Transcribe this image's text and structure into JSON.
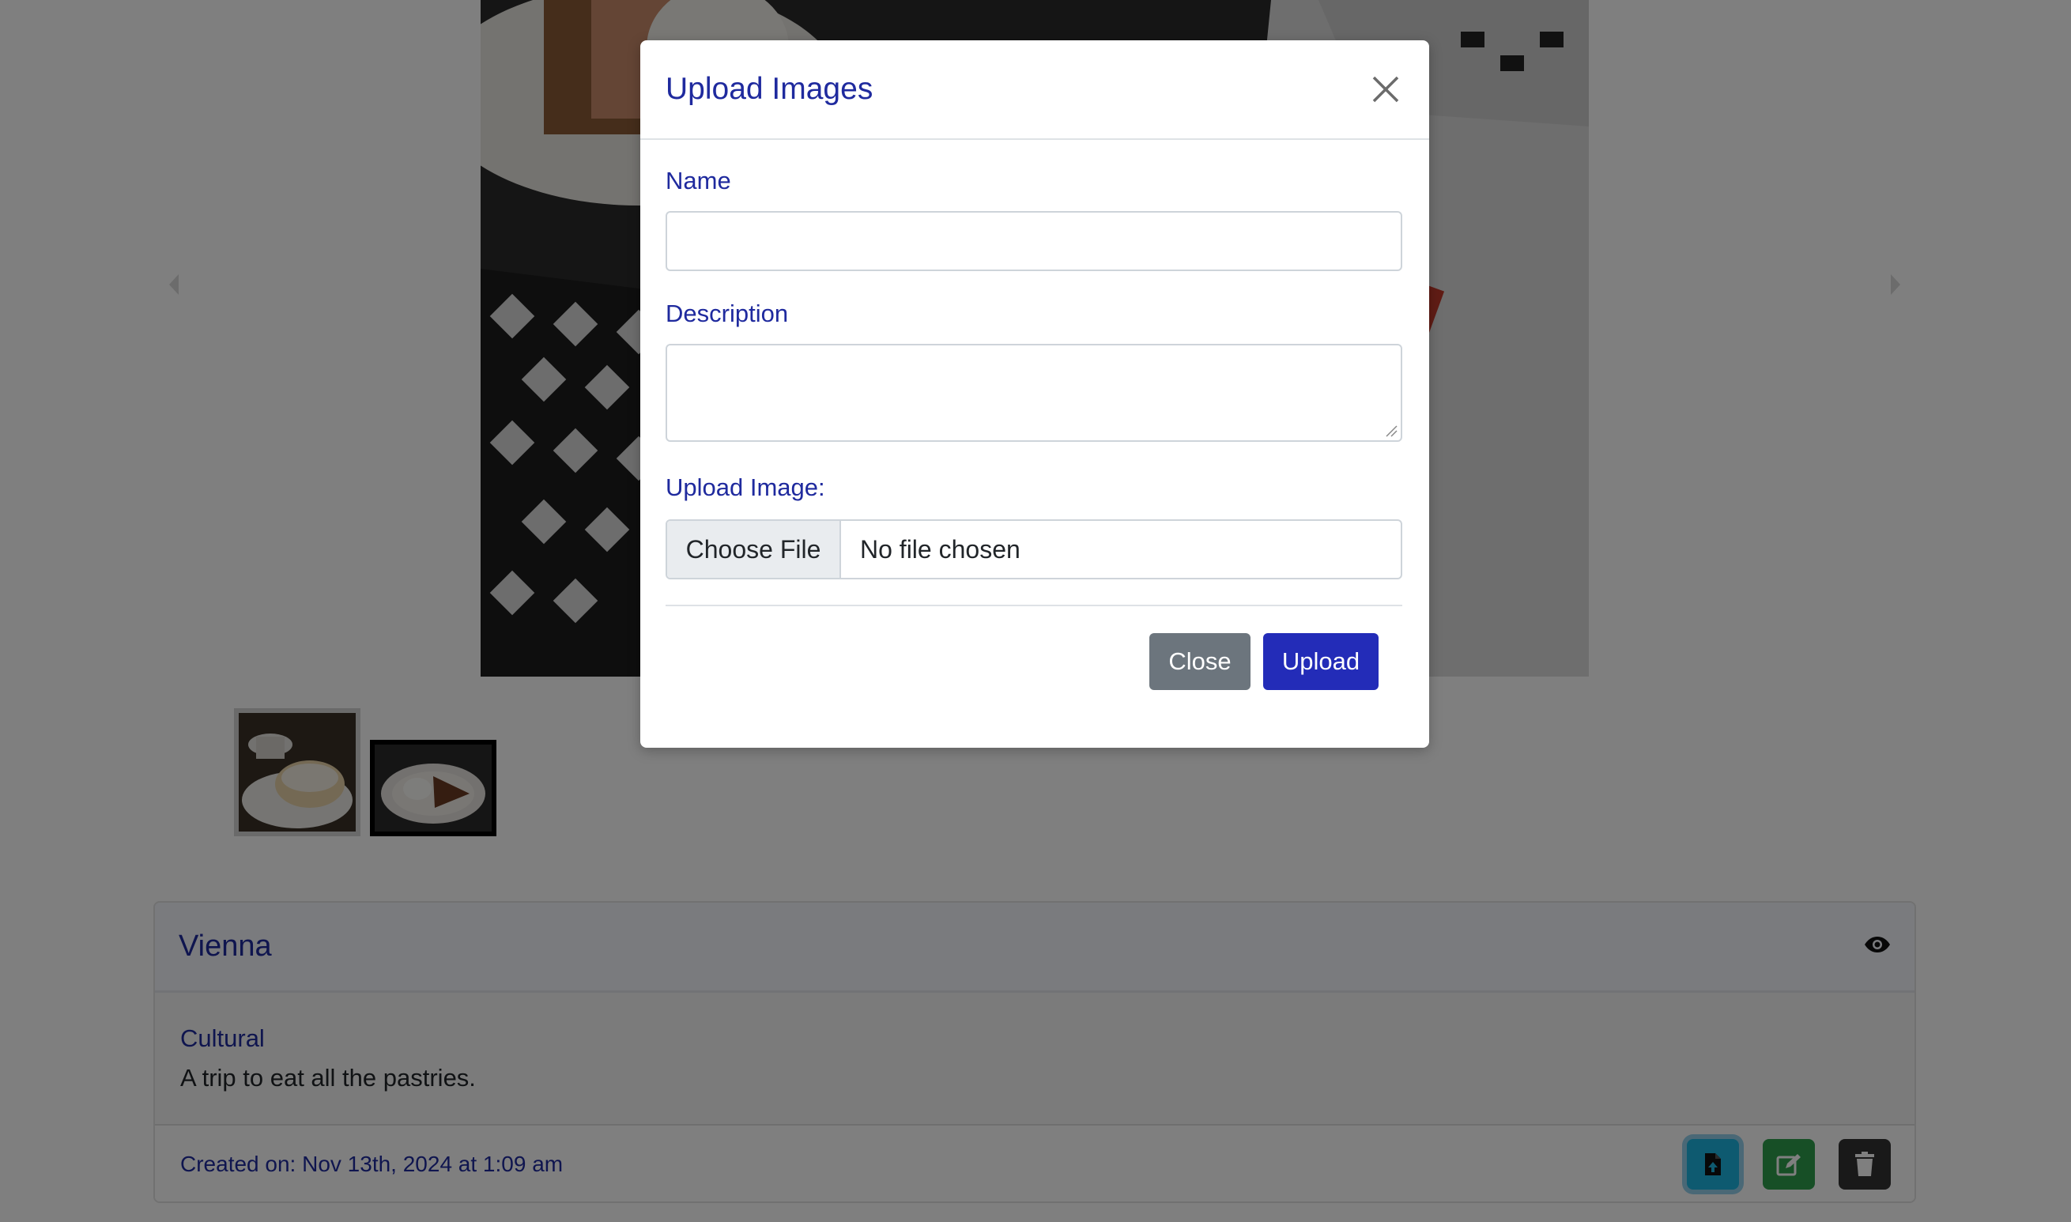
{
  "modal": {
    "title": "Upload Images",
    "close_icon": "close-x-icon",
    "name_label": "Name",
    "name_value": "",
    "description_label": "Description",
    "description_value": "",
    "upload_label": "Upload Image:",
    "choose_file_label": "Choose File",
    "file_status": "No file chosen",
    "close_button": "Close",
    "upload_button": "Upload"
  },
  "carousel": {
    "prev_icon": "chevron-left-icon",
    "next_icon": "chevron-right-icon",
    "thumbnails": [
      "pastry-thumbnail",
      "cake-thumbnail"
    ]
  },
  "trip": {
    "title": "Vienna",
    "visibility_icon": "eye-icon",
    "category": "Cultural",
    "description": "A trip to eat all the pastries.",
    "created": "Created on: Nov 13th, 2024 at 1:09 am",
    "actions": [
      {
        "icon": "file-upload-icon",
        "color": "#1cb5e0"
      },
      {
        "icon": "edit-icon",
        "color": "#2e9e4c"
      },
      {
        "icon": "trash-icon",
        "color": "#333333"
      }
    ]
  },
  "colors": {
    "primary": "#232cb8",
    "heading": "#1f2a9e",
    "secondary": "#6c757d",
    "backdrop": "rgba(0,0,0,0.5)"
  }
}
